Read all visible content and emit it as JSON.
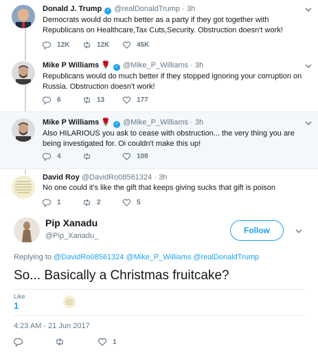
{
  "thread": [
    {
      "name": "Donald J. Trump",
      "verified": true,
      "handle": "@realDonaldTrump",
      "time": "3h",
      "text": "Democrats would do much better as a party if they got together with Republicans on Healthcare,Tax Cuts,Security. Obstruction doesn't work!",
      "replies": "12K",
      "retweets": "12K",
      "likes": "45K"
    },
    {
      "name": "Mike P Williams",
      "verified": true,
      "handle": "@Mike_P_Williams",
      "time": "3h",
      "text": "Republicans would do much better if they stopped ignoring your corruption on Russia. Obstruction doesn't work!",
      "replies": "6",
      "retweets": "13",
      "likes": "177"
    },
    {
      "name": "Mike P Williams",
      "verified": true,
      "handle": "@Mike_P_Williams",
      "time": "3h",
      "text": "Also HILARIOUS you ask to cease with obstruction... the very thing you are being investigated for. Oi couldn't make this up!",
      "replies": "4",
      "retweets": "",
      "likes": "108"
    },
    {
      "name": "David Roy",
      "verified": false,
      "handle": "@DavidRo08561324",
      "time": "3h",
      "text": "No one could it's like the gift that keeps giving sucks that gift is poison",
      "replies": "1",
      "retweets": "2",
      "likes": "5"
    }
  ],
  "main": {
    "name": "Pip Xanadu",
    "handle": "@Pip_Xanadu_",
    "follow_label": "Follow",
    "replying_prefix": "Replying to",
    "replying_to": "@DavidRo08561324 @Mike_P_Williams @realDonaldTrump",
    "text": "So... Basically a Christmas fruitcake?",
    "likes_label": "Like",
    "likes_count": "1",
    "timestamp": "4:23 AM - 21 Jun 2017",
    "action_likes": "1"
  },
  "colors": {
    "accent": "#1da1f2",
    "muted": "#657786",
    "rose": "#c0162b",
    "highlight_bg": "#f5f8fa"
  },
  "icons": [
    "reply-icon",
    "retweet-icon",
    "like-icon",
    "chevron-down-icon",
    "verified-icon",
    "rose-icon"
  ]
}
